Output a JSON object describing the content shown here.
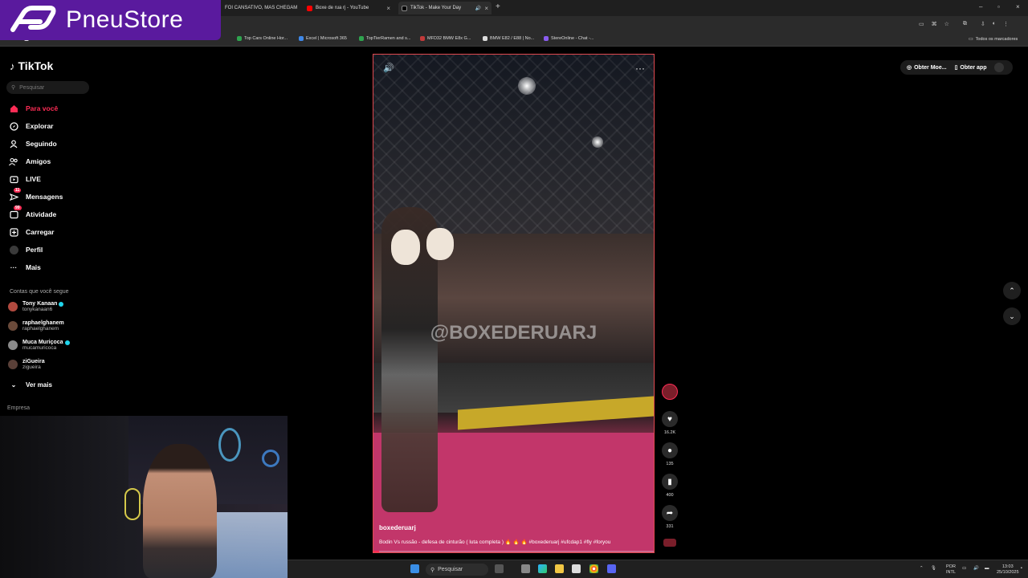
{
  "browser": {
    "tabs": [
      {
        "title": "FOI CANSATIVO, MAS CHEGAM"
      },
      {
        "title": "Boxe de rua rj - YouTube"
      },
      {
        "title": "TikTok - Make Your Day"
      }
    ],
    "bookmarks": [
      "Gmail",
      "Top Cars Online Hor...",
      "Excel | Microsoft 365",
      "TopTierRamen and s...",
      "MFD32 BMW E8x G...",
      "BMW E82 / E88 | No...",
      "StereOnline - Chat -...",
      "Todos os marcadores"
    ]
  },
  "overlay_logo": {
    "name": "PneuStore"
  },
  "sidebar": {
    "brand": "TikTok",
    "search_placeholder": "Pesquisar",
    "nav": [
      {
        "label": "Para você",
        "icon": "home-icon"
      },
      {
        "label": "Explorar",
        "icon": "compass-icon"
      },
      {
        "label": "Seguindo",
        "icon": "following-icon"
      },
      {
        "label": "Amigos",
        "icon": "friends-icon"
      },
      {
        "label": "LIVE",
        "icon": "live-icon"
      },
      {
        "label": "Mensagens",
        "icon": "message-icon",
        "badge": "11"
      },
      {
        "label": "Atividade",
        "icon": "activity-icon",
        "badge": "99"
      },
      {
        "label": "Carregar",
        "icon": "upload-icon"
      },
      {
        "label": "Perfil",
        "icon": "profile-icon"
      },
      {
        "label": "Mais",
        "icon": "more-icon"
      }
    ],
    "following_header": "Contas que você segue",
    "accounts": [
      {
        "name": "Tony Kanaan",
        "handle": "tonykanaan6",
        "verified": true
      },
      {
        "name": "raphaelghanem",
        "handle": "raphaelghanem",
        "verified": false
      },
      {
        "name": "Muca Muriçoca",
        "handle": "mucamuricoca",
        "verified": true
      },
      {
        "name": "ziGueira",
        "handle": "zigueira",
        "verified": false
      }
    ],
    "see_more": "Ver mais",
    "company": "Empresa"
  },
  "video": {
    "watermark": "@BOXEDERUARJ",
    "username": "boxederuarj",
    "caption": "Bodin Vs russão - defesa de cinturão ( luta completa ) 🔥 🔥 🔥 #boxederuarj #ufcdap1 #fly #foryou",
    "progress": 0.02
  },
  "actions": {
    "likes": "16.2K",
    "comments": "135",
    "saves": "400",
    "shares": "331"
  },
  "topright": {
    "coins": "Obter Moe...",
    "app": "Obter app"
  },
  "taskbar": {
    "search": "Pesquisar",
    "lang_top": "POR",
    "lang_bottom": "INTL",
    "time": "13:03",
    "date": "25/10/2025"
  },
  "colors": {
    "accent": "#fe2c55",
    "logo_bg": "#5a1a9e",
    "video_border": "#e0484f"
  }
}
